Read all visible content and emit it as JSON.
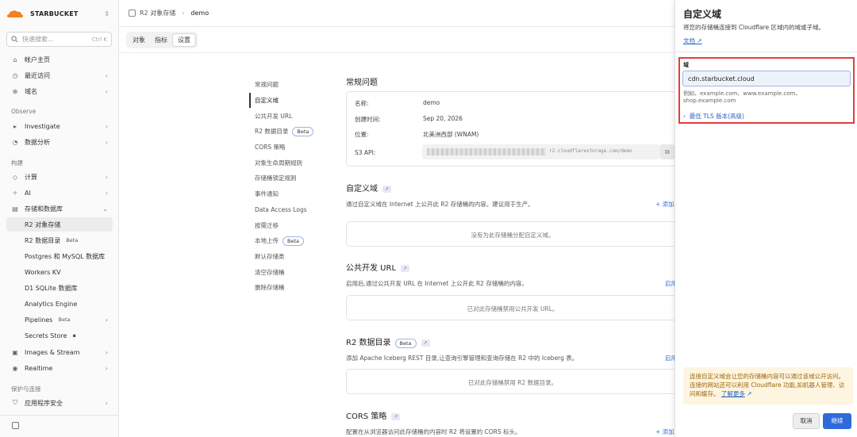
{
  "app": {
    "brand": "STARBUCKET",
    "switch_glyph": "⇕"
  },
  "sidebar": {
    "search_placeholder": "快速搜索...",
    "search_shortcut": "Ctrl K",
    "items": [
      {
        "label": "帐户主页",
        "icon": "home-icon"
      },
      {
        "label": "最近访问",
        "icon": "clock-icon"
      },
      {
        "label": "域名",
        "icon": "globe-icon"
      }
    ],
    "section_observe": "Observe",
    "observe_items": [
      {
        "label": "Investigate",
        "icon": "investigate-icon"
      },
      {
        "label": "数据分析",
        "icon": "analytics-icon"
      }
    ],
    "section_build": "构建",
    "build_items": [
      {
        "label": "计算",
        "icon": "compute-icon"
      },
      {
        "label": "AI",
        "icon": "ai-icon"
      },
      {
        "label": "存储和数据库",
        "icon": "storage-icon"
      }
    ],
    "storage_sub": [
      {
        "label": "R2 对象存储",
        "badge": ""
      },
      {
        "label": "R2 数据目录",
        "badge": "Beta"
      },
      {
        "label": "Postgres 和 MySQL 数据库",
        "badge": ""
      },
      {
        "label": "Workers KV",
        "badge": ""
      },
      {
        "label": "D1 SQLite 数据库",
        "badge": ""
      },
      {
        "label": "Analytics Engine",
        "badge": ""
      },
      {
        "label": "Pipelines",
        "badge": "Beta"
      },
      {
        "label": "Secrets Store",
        "badge": ""
      }
    ],
    "more_items": [
      {
        "label": "Images & Stream",
        "icon": "image-icon"
      },
      {
        "label": "Realtime",
        "icon": "realtime-icon"
      }
    ],
    "section_protect": "保护与连接",
    "protect_items": [
      {
        "label": "应用程序安全",
        "icon": "shield-icon"
      }
    ]
  },
  "header": {
    "breadcrumb_root": "R2 对象存储",
    "breadcrumb_current": "demo"
  },
  "tabs": [
    {
      "label": "对象",
      "active": false
    },
    {
      "label": "指标",
      "active": false
    },
    {
      "label": "设置",
      "active": true
    }
  ],
  "page_nav": [
    {
      "label": "常规问题",
      "active": false,
      "beta": false
    },
    {
      "label": "自定义域",
      "active": true,
      "beta": false
    },
    {
      "label": "公共开发 URL",
      "active": false,
      "beta": false
    },
    {
      "label": "R2 数据目录",
      "active": false,
      "beta": true
    },
    {
      "label": "CORS 策略",
      "active": false,
      "beta": false
    },
    {
      "label": "对象生命周期规则",
      "active": false,
      "beta": false
    },
    {
      "label": "存储桶锁定规则",
      "active": false,
      "beta": false
    },
    {
      "label": "事件通知",
      "active": false,
      "beta": false
    },
    {
      "label": "Data Access Logs",
      "active": false,
      "beta": false
    },
    {
      "label": "按需迁移",
      "active": false,
      "beta": false
    },
    {
      "label": "本地上传",
      "active": false,
      "beta": true
    },
    {
      "label": "默认存储类",
      "active": false,
      "beta": false
    },
    {
      "label": "清空存储桶",
      "active": false,
      "beta": false
    },
    {
      "label": "删除存储桶",
      "active": false,
      "beta": false
    }
  ],
  "beta_label": "Beta",
  "general": {
    "title": "常规问题",
    "name_label": "名称:",
    "name_value": "demo",
    "created_label": "创建时间:",
    "created_value": "Sep 20, 2026",
    "location_label": "位置:",
    "location_value": "北美洲西部 (WNAM)",
    "s3_label": "S3 API:",
    "s3_value_visible": "r2.cloudflarestorage.com/demo"
  },
  "custom_domain": {
    "title": "自定义域",
    "desc": "通过自定义域在 Internet 上公开此 R2 存储桶的内容。建议用于生产。",
    "add": "+ 添加",
    "empty": "没有为此存储桶分配自定义域。"
  },
  "public_url": {
    "title": "公共开发 URL",
    "desc": "启用后,通过公共开发 URL 在 Internet 上公开此 R2 存储桶的内容。",
    "action": "启用",
    "empty": "已对此存储桶禁用公共开发 URL。"
  },
  "catalog": {
    "title": "R2 数据目录",
    "desc": "添加 Apache Iceberg REST 目录,让查询引擎管理和查询存储在 R2 中的 Iceberg 表。",
    "action": "启用",
    "empty": "已对此存储桶禁用 R2 数据目录。"
  },
  "cors": {
    "title": "CORS 策略",
    "desc": "配置在从浏览器访问此存储桶的内容时 R2 将设置的 CORS 标头。",
    "add": "+ 添加"
  },
  "panel": {
    "title": "自定义域",
    "subtitle": "将您的存储桶连接到 Cloudflare 区域内的域或子域。",
    "doc_link": "文档",
    "field_label": "域",
    "field_value": "cdn.starbucket.cloud",
    "hint": "例如、example.com、www.example.com、shop.example.com",
    "tls_toggle": "最低 TLS 版本(高级)",
    "notice": "连接自定义域会让您的存储桶内容可以通过该域公开访问。连接的网站还可以利用 Cloudflare 功能,如机器人管理、访问和缓存。",
    "learn_more": "了解更多",
    "cancel": "取消",
    "continue": "继续"
  },
  "colors": {
    "accent": "#2f6ad9",
    "highlight": "#e53c3c",
    "notice_bg": "#fdf5e0"
  }
}
